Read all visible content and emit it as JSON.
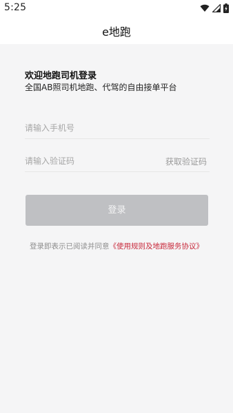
{
  "status_bar": {
    "time": "5:25",
    "icons": [
      "wifi-icon",
      "signal-icon",
      "battery-icon"
    ]
  },
  "header": {
    "title": "e地跑"
  },
  "welcome": {
    "title": "欢迎地跑司机登录",
    "subtitle": "全国AB照司机地跑、代驾的自由接单平台"
  },
  "form": {
    "phone_placeholder": "请输入手机号",
    "code_placeholder": "请输入验证码",
    "get_code_label": "获取验证码",
    "login_label": "登录"
  },
  "agreement": {
    "prefix": "登录即表示已阅读并同意",
    "link": "《使用规则及地跑服务协议》"
  },
  "colors": {
    "background": "#f5f5f6",
    "button_disabled": "#bfc0c3",
    "link": "#c8283a"
  }
}
